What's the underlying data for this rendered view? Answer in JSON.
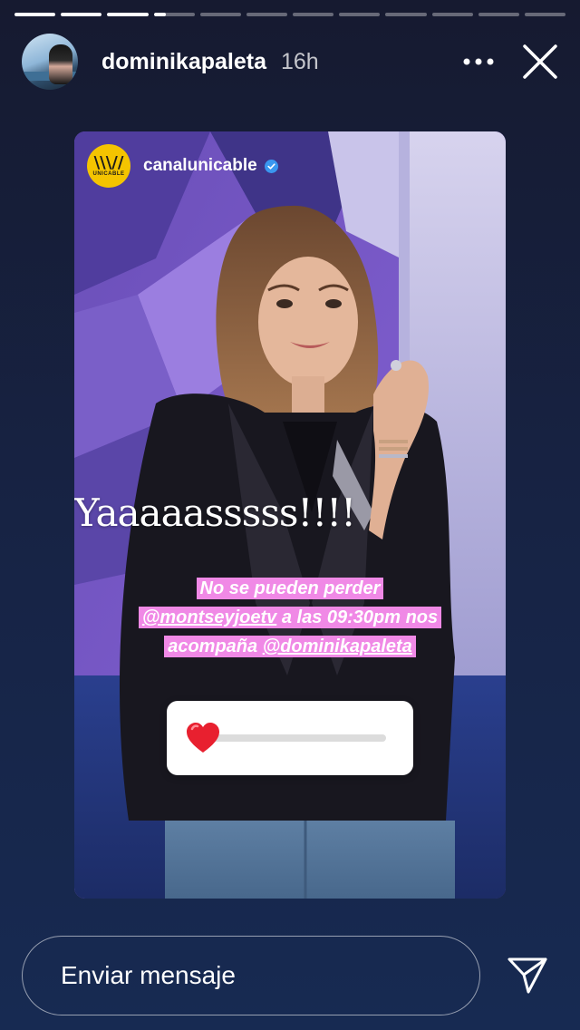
{
  "progress": {
    "segment_count": 12,
    "current_index": 3,
    "current_fraction": 0.3
  },
  "header": {
    "username": "dominikapaleta",
    "time_ago": "16h",
    "more_icon": "more-horizontal-icon",
    "close_icon": "close-icon"
  },
  "story": {
    "shared_from": {
      "username": "canalunicable",
      "logo_text": "UNICABLE",
      "verified": true
    },
    "headline": "Yaaaaasssss!!!!",
    "caption": {
      "line1": "No se pueden perder",
      "mention1": "@montseyjoetv",
      "line2_rest": " a las 09:30pm nos",
      "line3_start": "acompaña ",
      "mention2": "@dominikapaleta"
    },
    "emoji_slider": {
      "emoji": "❤️",
      "value": 0.0
    },
    "colors": {
      "caption_highlight": "#f089e6",
      "logo_yellow": "#f4c400",
      "verified_blue": "#3a97f0"
    }
  },
  "composer": {
    "placeholder": "Enviar mensaje",
    "send_icon": "send-icon"
  }
}
